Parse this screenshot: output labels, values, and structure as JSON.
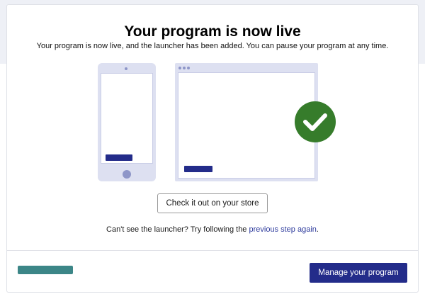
{
  "modal": {
    "title": "Your program is now live",
    "subtitle": "Your program is now live, and the launcher has been added. You can pause your program at any time.",
    "check_button_label": "Check it out on your store",
    "hint_prefix": "Can't see the launcher? Try following the ",
    "hint_link": "previous step again",
    "hint_suffix": ".",
    "manage_button_label": "Manage your program"
  },
  "icons": {
    "success": "check-icon",
    "phone": "phone-illustration",
    "browser": "browser-illustration"
  },
  "colors": {
    "primary": "#232c8a",
    "success": "#367c2b",
    "link": "#2d3a9c",
    "illustration": "#dde0f1",
    "teal_placeholder": "#3c8687"
  }
}
